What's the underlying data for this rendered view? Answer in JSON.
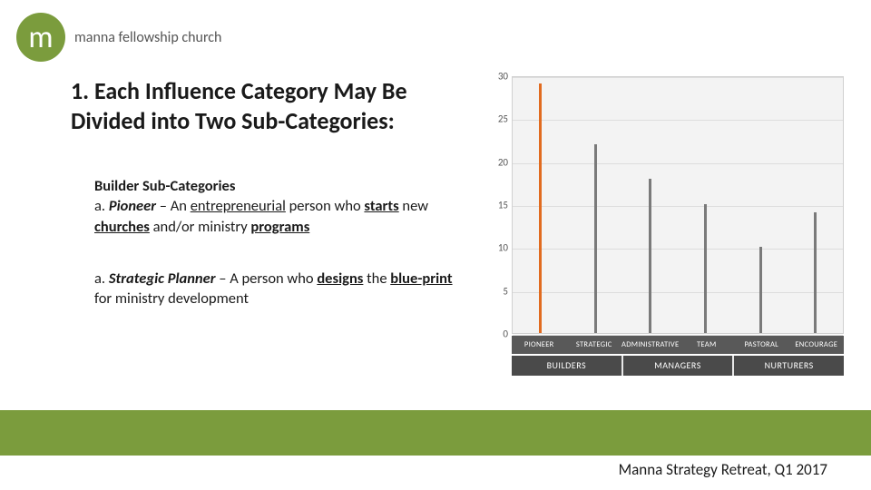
{
  "logo": {
    "letter": "m",
    "text": "manna fellowship church"
  },
  "heading": "1. Each Influence Category May Be Divided into Two Sub-Categories:",
  "builder": {
    "title": "Builder Sub-Categories",
    "a_prefix": "a.",
    "pioneer_label": "Pioneer",
    "pioneer_dash": " – An ",
    "pioneer_u1": "entrepreneurial",
    "pioneer_mid": " person who ",
    "pioneer_u2": "starts",
    "pioneer_mid2": " new ",
    "pioneer_u3": "churches",
    "pioneer_mid3": " and/or ministry ",
    "pioneer_u4": "programs",
    "sp_label": "Strategic Planner",
    "sp_dash": " – A person who ",
    "sp_u1": "designs",
    "sp_mid": " the ",
    "sp_u2": "blue-print",
    "sp_tail": " for ministry development"
  },
  "footer": "Manna Strategy Retreat, Q1 2017",
  "chart_data": {
    "type": "bar",
    "categories": [
      "PIONEER",
      "STRATEGIC",
      "ADMINISTRATIVE",
      "TEAM",
      "PASTORAL",
      "ENCOURAGE"
    ],
    "values": [
      29,
      22,
      18,
      15,
      10,
      14
    ],
    "colors": [
      "#e16b1f",
      "#7a7a7a",
      "#7a7a7a",
      "#7a7a7a",
      "#7a7a7a",
      "#7a7a7a"
    ],
    "ylim": [
      0,
      30
    ],
    "yticks": [
      0,
      5,
      10,
      15,
      20,
      25,
      30
    ],
    "groups": [
      {
        "label": "BUILDERS",
        "span": 2
      },
      {
        "label": "MANAGERS",
        "span": 2
      },
      {
        "label": "NURTURERS",
        "span": 2
      }
    ]
  }
}
